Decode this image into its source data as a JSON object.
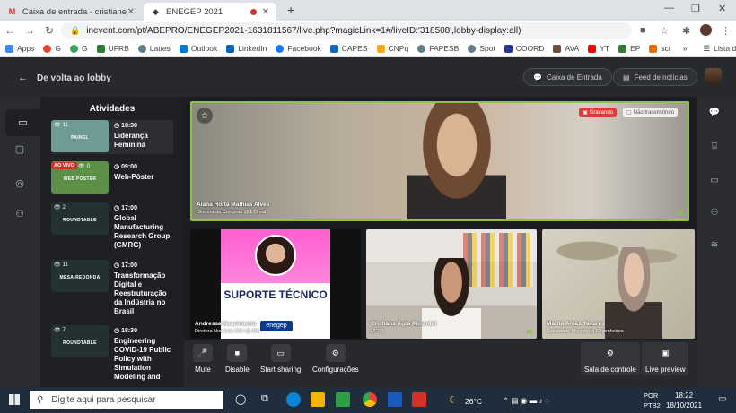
{
  "browser": {
    "tabs": [
      {
        "title": "Caixa de entrada - cristianepimen",
        "icon": "M"
      },
      {
        "title": "ENEGEP 2021",
        "icon": "◆"
      }
    ],
    "new_tab": "+",
    "url": "inevent.com/pt/ABEPRO/ENEGEP2021-1631811567/live.php?magicLink=1#/liveID:'318508',lobby-display:all)",
    "bookmarks": [
      "Apps",
      "G",
      "G",
      "UFRB",
      "Lattes",
      "Outlook",
      "LinkedIn",
      "Facebook",
      "CAPES",
      "CNPq",
      "FAPESB",
      "Spot",
      "COORD",
      "AVA",
      "YT",
      "EP",
      "sci"
    ],
    "bookmarks_more": "»",
    "reading_list": "Lista de leitura"
  },
  "app": {
    "back_label": "De volta ao lobby",
    "inbox_button": "Caixa de Entrada",
    "news_button": "Feed de notícias",
    "panel_title": "Atividades",
    "activities": [
      {
        "count": "11",
        "thumb_title": "PAINEL",
        "time": "18:30",
        "name": "Liderança Feminina",
        "color": "#6e9c94"
      },
      {
        "count": "0",
        "thumb_title": "WEB PÔSTER",
        "time": "09:00",
        "name": "Web-Pôster",
        "color": "#5d8f49",
        "live": "AO VIVO"
      },
      {
        "count": "2",
        "thumb_title": "ROUNDTABLE",
        "time": "17:00",
        "name": "Global Manufacturing Research Group (GMRG)",
        "color": "#233132"
      },
      {
        "count": "11",
        "thumb_title": "MESA-REDONDA",
        "time": "17:00",
        "name": "Transformação Digital e Reestruturação da Indústria no Brasil",
        "color": "#233132"
      },
      {
        "count": "7",
        "thumb_title": "ROUNDTABLE",
        "time": "18:30",
        "name": "Engineering COVID-19 Public Policy with Simulation Modeling and",
        "color": "#233132"
      }
    ],
    "recording_label": "Gravando",
    "not_transmitting_label": "Não transmitindo",
    "participants": [
      {
        "name": "Alana Horta Mathias Alves",
        "role": "Diretora de Compras @ L'Oreal"
      },
      {
        "name": "Andressa Nascimento",
        "role": "Diretora Nordeste ABJ @ ABJ",
        "banner": "SUPORTE TÉCNICO",
        "logo": "enegep"
      },
      {
        "name": "Cristiane Agra Pimentel",
        "role": "UFRB"
      },
      {
        "name": "Marita Arêas Tavares",
        "role": "Sociedade Mineira de Engenheiros"
      }
    ],
    "controls": [
      {
        "label": "Mute",
        "icon": "microphone-icon"
      },
      {
        "label": "Disable",
        "icon": "camera-icon"
      },
      {
        "label": "Start sharing",
        "icon": "screen-share-icon"
      },
      {
        "label": "Configurações",
        "icon": "settings-icon"
      }
    ],
    "right_controls": [
      {
        "label": "Sala de controle",
        "icon": "control-room-icon"
      },
      {
        "label": "Live preview",
        "icon": "live-preview-icon"
      }
    ]
  },
  "taskbar": {
    "search_placeholder": "Digite aqui para pesquisar",
    "weather": "26°C",
    "lang1": "POR",
    "lang2": "PTB2",
    "time": "18:22",
    "date": "18/10/2021"
  }
}
